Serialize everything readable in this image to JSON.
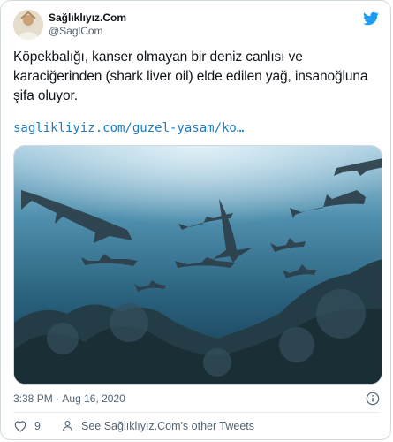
{
  "author": {
    "name": "Sağlıklıyız.Com",
    "handle": "@SaglCom"
  },
  "tweet": {
    "text": "Köpekbalığı, kanser olmayan bir deniz canlısı ve karaciğerinden (shark liver oil) elde edilen yağ, insanoğluna şifa oluyor.",
    "link": "saglikliyiz.com/guzel-yasam/ko…",
    "time": "3:38 PM",
    "separator": "·",
    "date": "Aug 16, 2020"
  },
  "actions": {
    "like_count": "9",
    "see_more": "See Sağlıklıyız.Com's other Tweets"
  },
  "icons": {
    "brand": "twitter-bird-icon",
    "info": "info-icon",
    "like": "heart-icon",
    "profile": "person-icon"
  },
  "colors": {
    "twitter_blue": "#1d9bf0",
    "link": "#1b7ec7",
    "secondary_text": "#536471"
  }
}
